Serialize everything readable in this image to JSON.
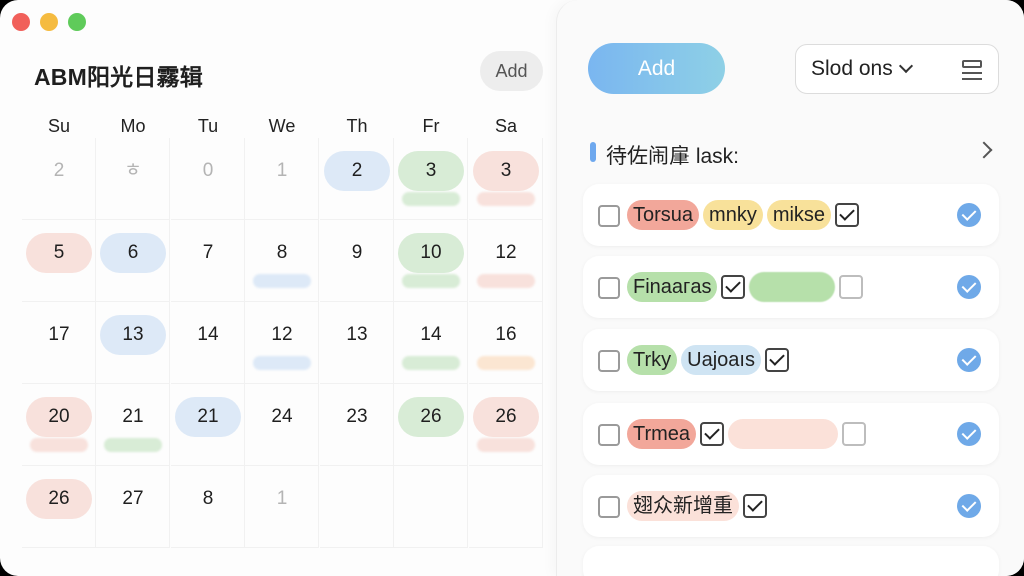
{
  "calendar": {
    "title": "ABM阳光日霧辑",
    "add_label": "Add",
    "weekdays": [
      "Su",
      "Mo",
      "Tu",
      "We",
      "Th",
      "Fr",
      "Sa"
    ],
    "cells": [
      [
        "2",
        "ㅎ",
        "0",
        "1",
        "2",
        "3",
        "3"
      ],
      [
        "5",
        "6",
        "7",
        "8",
        "9",
        "10",
        "12"
      ],
      [
        "17",
        "13",
        "14",
        "12",
        "13",
        "14",
        "16"
      ],
      [
        "20",
        "21",
        "21",
        "24",
        "23",
        "26",
        "26"
      ],
      [
        "26",
        "27",
        "8",
        "1",
        "",
        "",
        ""
      ]
    ]
  },
  "panel": {
    "add_label": "Add",
    "select_value": "Slod ons",
    "section_label": "待佐闹肁 lask:",
    "tasks": [
      {
        "tags": [
          "Torsua",
          "mnky",
          "mikse"
        ]
      },
      {
        "tags": [
          "Finaагas"
        ]
      },
      {
        "tags": [
          "Trky",
          "Uajoaıs"
        ]
      },
      {
        "tags": [
          "Trmea"
        ]
      },
      {
        "tags": [
          "翅众新增重"
        ]
      }
    ]
  },
  "colors": {
    "accent": "#6fa9e8",
    "tag_red": "#f2a79a",
    "tag_yellow": "#f8e19a",
    "tag_green": "#b6e0aa",
    "tag_blue": "#cfe4f3"
  }
}
